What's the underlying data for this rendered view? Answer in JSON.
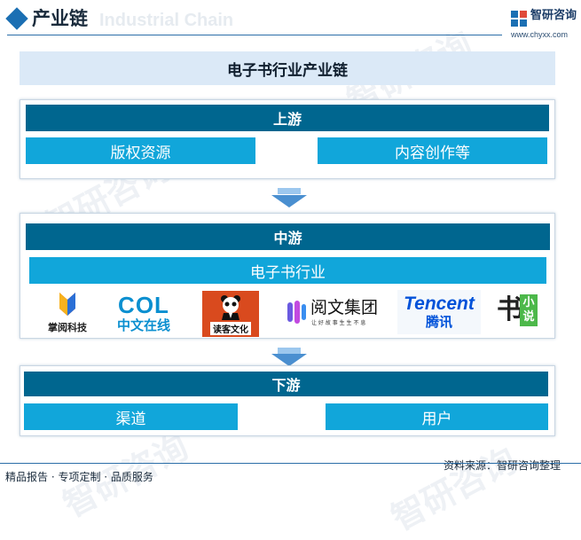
{
  "header": {
    "title": "产业链",
    "title_en": "Industrial Chain",
    "brand_name": "智研咨询",
    "brand_url": "www.chyxx.com"
  },
  "watermark": {
    "text": "智研咨询"
  },
  "diagram": {
    "title": "电子书行业产业链",
    "upstream": {
      "label": "上游",
      "items": [
        "版权资源",
        "内容创作等"
      ]
    },
    "midstream": {
      "label": "中游",
      "industry": "电子书行业",
      "logos": [
        {
          "icon": "zhangyue-logo-icon",
          "text": "掌阅科技"
        },
        {
          "icon": "col-logo-icon",
          "text": "中文在线",
          "mark": "COL"
        },
        {
          "icon": "panda-logo-icon",
          "text": "读客文化"
        },
        {
          "icon": "yuewen-logo-icon",
          "text": "阅文集团",
          "sub": "让 好 故 事 生 生 不 息"
        },
        {
          "icon": "tencent-logo-icon",
          "text": "腾讯",
          "mark": "Tencent"
        },
        {
          "icon": "shuqi-logo-icon",
          "text": "书",
          "sub": "小说"
        }
      ]
    },
    "downstream": {
      "label": "下游",
      "items": [
        "渠道",
        "用户"
      ]
    }
  },
  "footer": {
    "left": "精品报告 · 专项定制 · 品质服务",
    "source": "资料来源：智研咨询整理"
  },
  "colors": {
    "section_header": "#00668f",
    "sub_box": "#11a6da",
    "title_band": "#dbe9f7",
    "accent": "#1b6fb3"
  }
}
